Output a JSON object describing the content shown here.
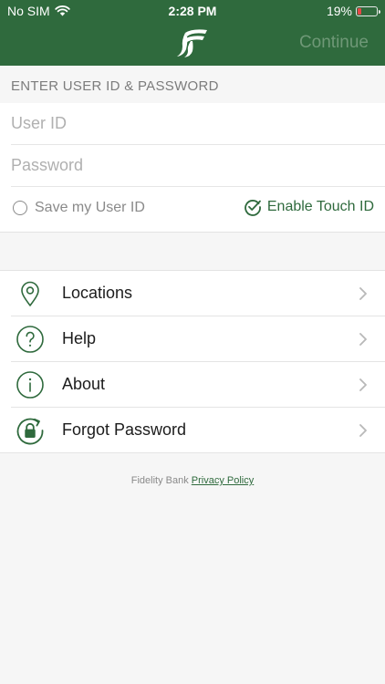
{
  "status_bar": {
    "carrier": "No SIM",
    "time": "2:28 PM",
    "battery_text": "19%",
    "battery_level_percent": 19,
    "battery_color": "#e64646"
  },
  "header": {
    "logo_icon": "fidelity-bank-logo-icon",
    "continue_label": "Continue",
    "background_color": "#2f6a3d"
  },
  "login": {
    "section_header": "ENTER USER ID & PASSWORD",
    "user_id_placeholder": "User ID",
    "user_id_value": "",
    "password_placeholder": "Password",
    "password_value": "",
    "save_user_id_label": "Save my User ID",
    "save_user_id_checked": false,
    "enable_touch_id_label": "Enable Touch ID",
    "enable_touch_id_checked": true
  },
  "menu": {
    "items": [
      {
        "label": "Locations",
        "icon": "location-pin-icon"
      },
      {
        "label": "Help",
        "icon": "question-circle-icon"
      },
      {
        "label": "About",
        "icon": "info-circle-icon"
      },
      {
        "label": "Forgot Password",
        "icon": "lock-refresh-icon"
      }
    ]
  },
  "footer": {
    "bank_name": "Fidelity Bank",
    "privacy_link": "Privacy Policy"
  }
}
